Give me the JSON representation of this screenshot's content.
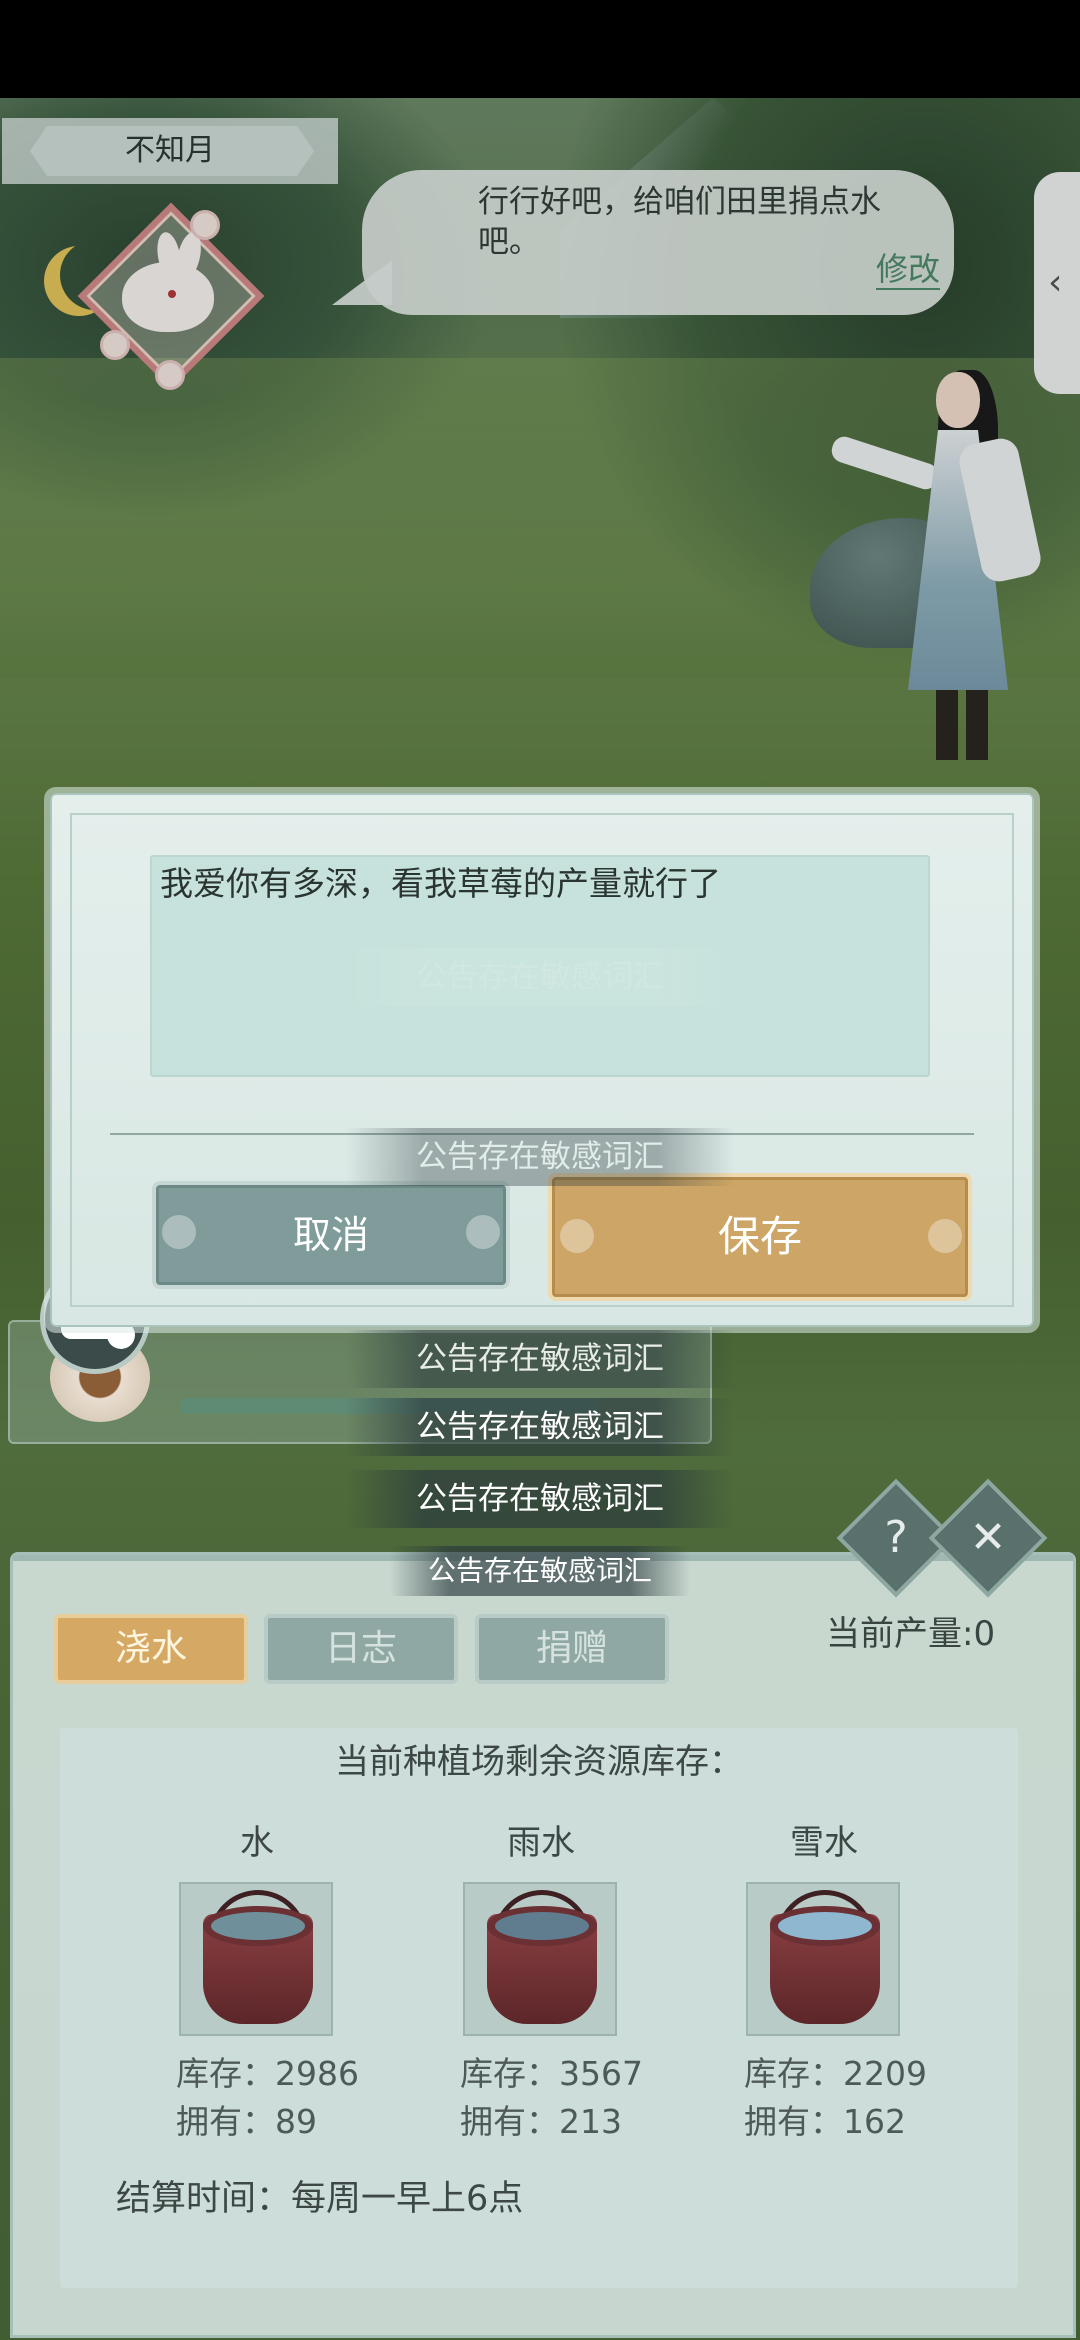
{
  "header": {
    "player_name": "不知月",
    "speech_text": "行行好吧，给咱们田里捐点水吧。",
    "edit_label": "修改",
    "side_tab_icon": "chevron-left-icon"
  },
  "dialog": {
    "input_value": "我爱你有多深，看我草莓的产量就行了",
    "cancel_label": "取消",
    "save_label": "保存"
  },
  "toasts": [
    "公告存在敏感词汇",
    "公告存在敏感词汇",
    "公告存在敏感词汇",
    "公告存在敏感词汇",
    "公告存在敏感词汇",
    "公告存在敏感词汇"
  ],
  "panel": {
    "tabs": [
      "浇水",
      "日志",
      "捐赠"
    ],
    "active_tab": "浇水",
    "production": "当前产量:0",
    "help_icon": "question-icon",
    "close_icon": "close-icon",
    "inventory_title": "当前种植场剩余资源库存：",
    "resources": [
      {
        "name": "水",
        "stock": "库存：2986",
        "owned": "拥有：89",
        "water_color": "#6f8f9a"
      },
      {
        "name": "雨水",
        "stock": "库存：3567",
        "owned": "拥有：213",
        "water_color": "#5f7d8f"
      },
      {
        "name": "雪水",
        "stock": "库存：2209",
        "owned": "拥有：162",
        "water_color": "#8fb7cf"
      }
    ],
    "settlement": "结算时间：每周一早上6点"
  },
  "colors": {
    "save_button": "#cda566",
    "cancel_button": "#7f9c9a",
    "active_tab": "#d5a863",
    "accent_green": "#4f8a6c"
  }
}
